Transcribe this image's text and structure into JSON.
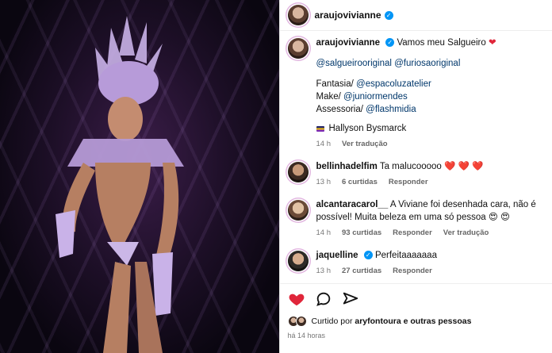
{
  "header": {
    "username": "araujovivianne"
  },
  "post": {
    "username": "araujovivianne",
    "caption": "Vamos meu Salgueiro",
    "mentions_line": "@salgueirooriginal @furiosaoriginal",
    "credits": [
      {
        "label": "Fantasia/",
        "mention": "@espacoluzatelier"
      },
      {
        "label": "Make/",
        "mention": "@juniormendes"
      },
      {
        "label": "Assessoria/",
        "mention": "@flashmidia"
      }
    ],
    "photo_credit": "Hallyson Bysmarck",
    "time": "14 h",
    "translate": "Ver tradução"
  },
  "comments": [
    {
      "username": "bellinhadelfim",
      "text": "Ta malucooooo",
      "hearts": "❤️ ❤️ ❤️",
      "time": "13 h",
      "likes": "6 curtidas",
      "reply": "Responder"
    },
    {
      "username": "alcantaracarol__",
      "text": "A Viviane foi desenhada cara, não é possível! Muita beleza em uma só pessoa",
      "hearts": "😍 😍",
      "time": "14 h",
      "likes": "93 curtidas",
      "reply": "Responder",
      "translate": "Ver tradução"
    },
    {
      "username": "jaquelline",
      "text": "Perfeitaaaaaaa",
      "time": "13 h",
      "likes": "27 curtidas",
      "reply": "Responder"
    }
  ],
  "footer": {
    "liked_by_prefix": "Curtido por",
    "liked_by_user": "aryfontoura",
    "liked_by_suffix": "e outras pessoas",
    "timestamp": "há 14 horas"
  },
  "colors": {
    "heart": "#e0263a",
    "verified": "#0095f6",
    "mention": "#00376b"
  }
}
